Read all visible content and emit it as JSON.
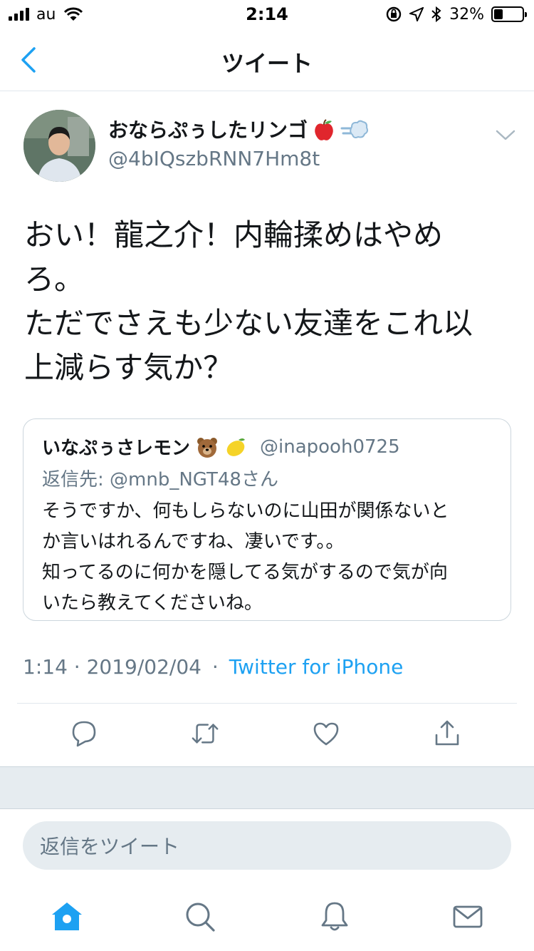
{
  "status_bar": {
    "carrier": "au",
    "time": "2:14",
    "battery_percent": "32%",
    "battery_level": 0.32
  },
  "nav": {
    "title": "ツイート"
  },
  "tweet": {
    "display_name": "おならぷぅしたリンゴ",
    "name_emojis": [
      "apple-icon",
      "dash-icon"
    ],
    "handle": "@4bIQszbRNN7Hm8t",
    "text": "おい！龍之介！内輪揉めはやめ\nろ。\nただでさえも少ない友達をこれ以\n上減らす気か？",
    "timestamp": "1:14 · 2019/02/04",
    "separator": "·",
    "source": "Twitter for iPhone"
  },
  "quote": {
    "display_name": "いなぷぅさレモン",
    "name_emojis": [
      "bear-icon",
      "lemon-icon"
    ],
    "handle": "@inapooh0725",
    "reply_to": "返信先: @mnb_NGT48さん",
    "text": "そうですか、何もしらないのに山田が関係ないと\nか言いはれるんですね、凄いです。。\n知ってるのに何かを隠してる気がするので気が向\nいたら教えてくださいね。"
  },
  "reply": {
    "placeholder": "返信をツイート"
  },
  "colors": {
    "accent": "#1da1f2",
    "secondary_text": "#657786",
    "border": "#e1e8ed",
    "band": "#e6ecf0"
  }
}
